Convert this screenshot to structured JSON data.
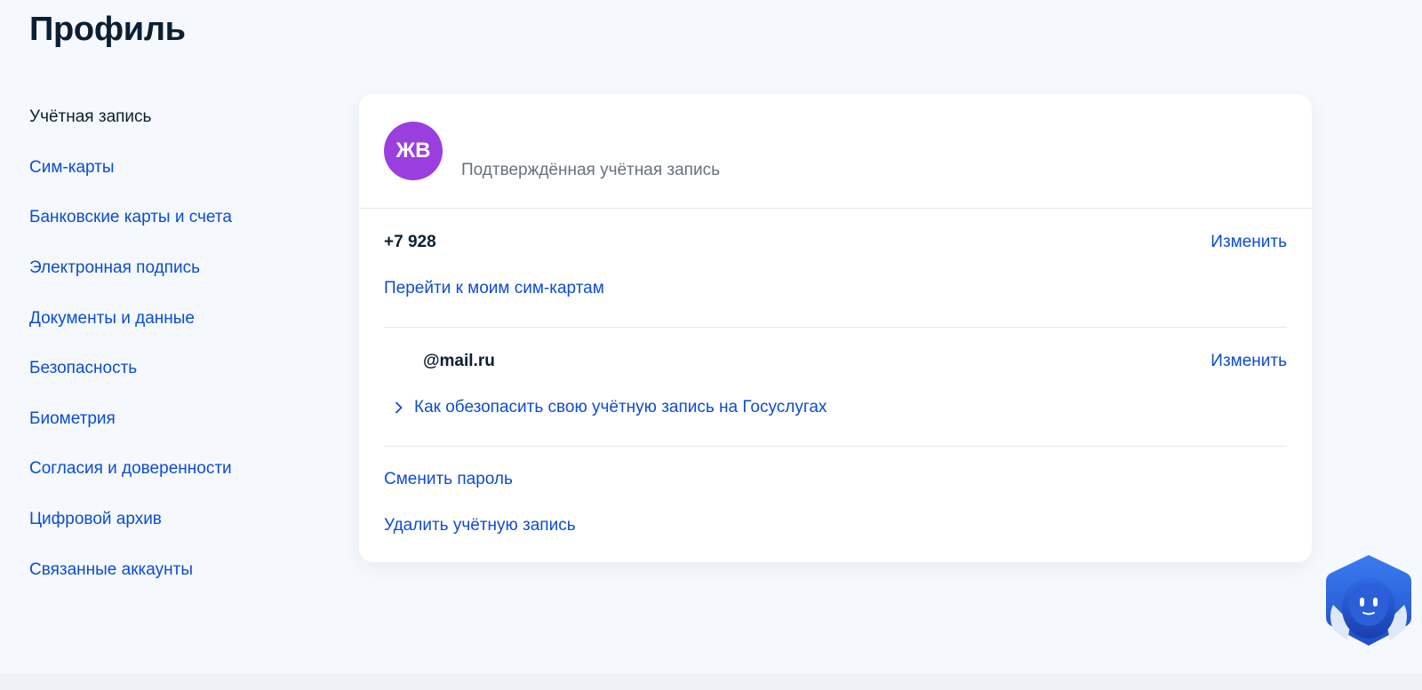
{
  "page": {
    "title": "Профиль"
  },
  "sidebar": {
    "items": [
      {
        "label": "Учётная запись",
        "active": true
      },
      {
        "label": "Сим-карты",
        "active": false
      },
      {
        "label": "Банковские карты и счета",
        "active": false
      },
      {
        "label": "Электронная подпись",
        "active": false
      },
      {
        "label": "Документы и данные",
        "active": false
      },
      {
        "label": "Безопасность",
        "active": false
      },
      {
        "label": "Биометрия",
        "active": false
      },
      {
        "label": "Согласия и доверенности",
        "active": false
      },
      {
        "label": "Цифровой архив",
        "active": false
      },
      {
        "label": "Связанные аккаунты",
        "active": false
      }
    ]
  },
  "account": {
    "avatar_initials": "ЖВ",
    "status_label": "Подтверждённая учётная запись",
    "phone": {
      "value": "+7 928",
      "change_label": "Изменить",
      "goto_sims_label": "Перейти к моим сим-картам"
    },
    "email": {
      "value": "@mail.ru",
      "change_label": "Изменить",
      "secure_link_label": "Как обезопасить свою учётную запись на Госуслугах"
    },
    "change_password_label": "Сменить пароль",
    "delete_account_label": "Удалить учётную запись"
  },
  "colors": {
    "link": "#0d4cd3",
    "text": "#0b1f33",
    "muted": "#66727f",
    "avatar_bg": "#9b3ee0",
    "page_bg": "#f5f8fc"
  },
  "icons": {
    "chevron": "chevron-right-icon",
    "assistant": "assistant-robot-icon"
  }
}
